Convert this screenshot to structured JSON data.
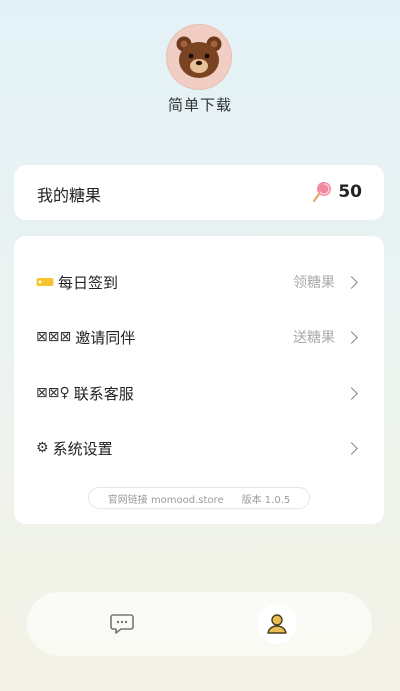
{
  "profile": {
    "app_name": "简单下载"
  },
  "candy": {
    "title": "我的糖果",
    "count": "50"
  },
  "menu": {
    "checkin": {
      "label": "每日签到",
      "hint": "领糖果"
    },
    "invite": {
      "icon_text": "⊠⊠⊠",
      "label": "邀请同伴",
      "hint": "送糖果"
    },
    "support": {
      "icon_text": "⊠⊠♀",
      "label": "联系客服"
    },
    "settings": {
      "icon_text": "⚙",
      "label": "系统设置"
    }
  },
  "footer": {
    "site": "官网链接 momood.store",
    "version": "版本 1.0.5"
  },
  "tabbar": {
    "active": "me"
  },
  "colors": {
    "candy_pink": "#f08aa0",
    "ticket_yellow": "#f4c431",
    "avatar_bg": "#f1cdc3",
    "me_icon": "#d9a93d"
  }
}
